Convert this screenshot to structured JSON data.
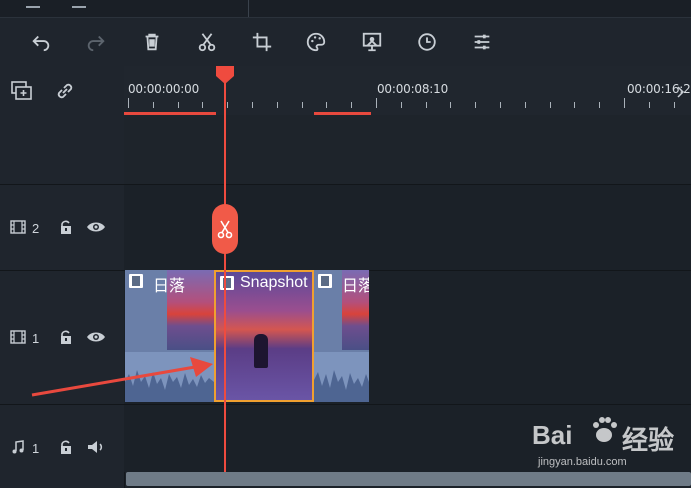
{
  "toolbar": {
    "items": [
      "undo-icon",
      "redo-icon",
      "delete-icon",
      "scissors-icon",
      "crop-icon",
      "color-palette-icon",
      "freeze-frame-icon",
      "speed-clock-icon",
      "adjust-sliders-icon"
    ]
  },
  "ruler": {
    "timecodes": [
      "00:00:00:00",
      "00:00:08:10",
      "00:00:16:2"
    ]
  },
  "tracks": {
    "video2": {
      "label": "2"
    },
    "video1": {
      "label": "1"
    },
    "audio1": {
      "label": "1"
    }
  },
  "clips": [
    {
      "title": "日落"
    },
    {
      "title": "Snapshot"
    },
    {
      "title": "日落"
    }
  ],
  "watermark": {
    "brand": "Bai",
    "brand2": "经验",
    "url": "jingyan.baidu.com"
  },
  "colors": {
    "accent": "#ef4b3f",
    "selection": "#f0a030",
    "background": "#1c2229"
  }
}
